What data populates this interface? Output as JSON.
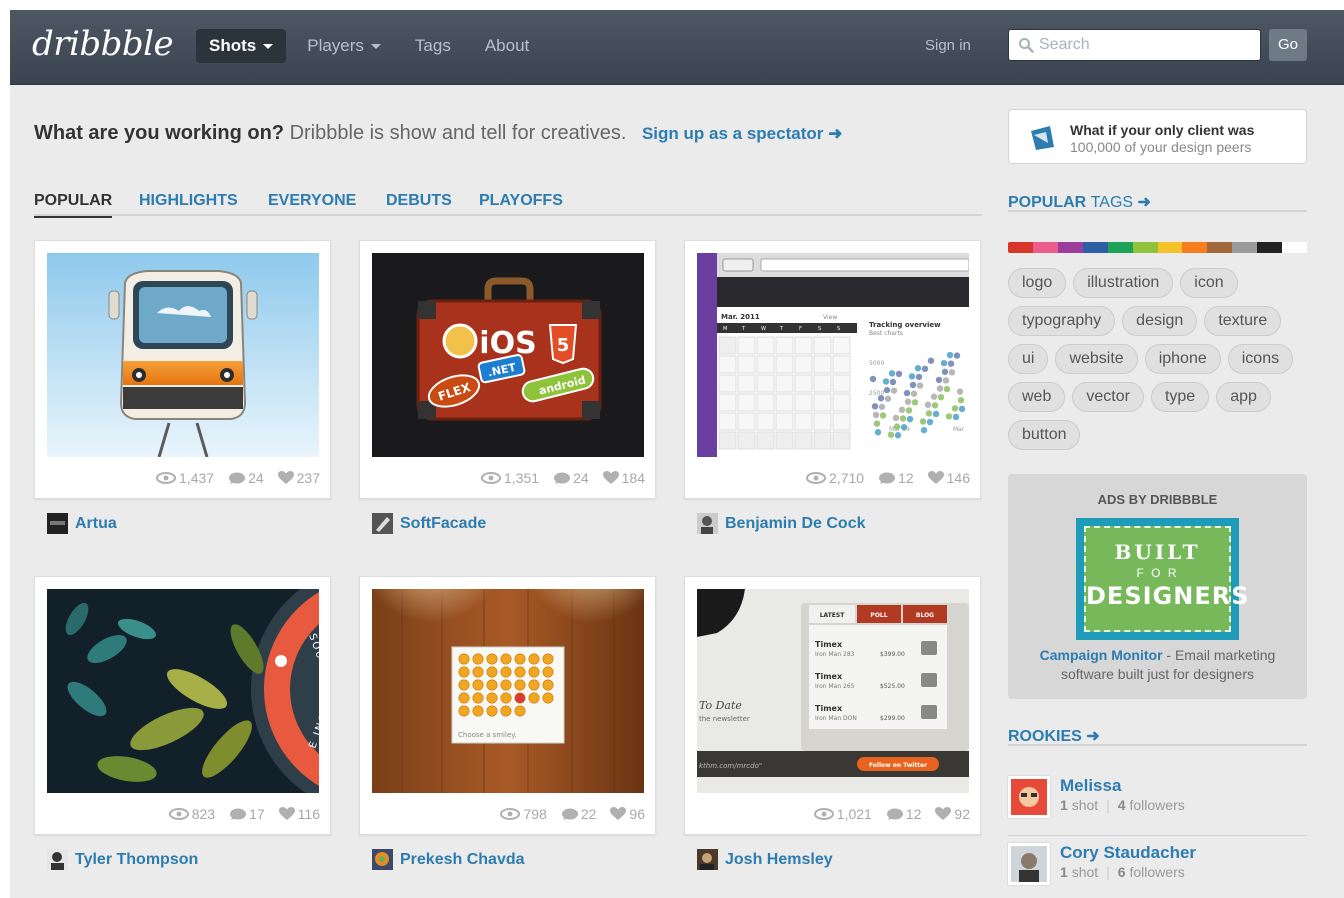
{
  "header": {
    "logo": "dribbble",
    "nav": [
      {
        "label": "Shots",
        "active": true,
        "dropdown": true
      },
      {
        "label": "Players",
        "active": false,
        "dropdown": true
      },
      {
        "label": "Tags",
        "active": false,
        "dropdown": false
      },
      {
        "label": "About",
        "active": false,
        "dropdown": false
      }
    ],
    "signin": "Sign in",
    "search_placeholder": "Search",
    "go_label": "Go"
  },
  "intro": {
    "question": "What are you working on?",
    "tagline": "Dribbble is show and tell for creatives.",
    "signup": "Sign up as a spectator",
    "arrow": "➜"
  },
  "tabs": [
    {
      "label": "Popular",
      "active": true
    },
    {
      "label": "Highlights",
      "active": false
    },
    {
      "label": "Everyone",
      "active": false
    },
    {
      "label": "Debuts",
      "active": false
    },
    {
      "label": "Playoffs",
      "active": false
    }
  ],
  "shots": [
    {
      "views": "1,437",
      "comments": "24",
      "likes": "237",
      "player": "Artua"
    },
    {
      "views": "1,351",
      "comments": "24",
      "likes": "184",
      "player": "SoftFacade"
    },
    {
      "views": "2,710",
      "comments": "12",
      "likes": "146",
      "player": "Benjamin De Cock"
    },
    {
      "views": "823",
      "comments": "17",
      "likes": "116",
      "player": "Tyler Thompson"
    },
    {
      "views": "798",
      "comments": "22",
      "likes": "96",
      "player": "Prekesh Chavda"
    },
    {
      "views": "1,021",
      "comments": "12",
      "likes": "92",
      "player": "Josh Hemsley"
    }
  ],
  "shot_art": {
    "suitcase_ios": "iOS",
    "suitcase_html": "5",
    "suitcase_net": ".NET",
    "suitcase_flex": "FLEX",
    "suitcase_android": "android",
    "calendar_month": "Mar. 2011",
    "calendar_view": "View",
    "calendar_days": [
      "M",
      "T",
      "W",
      "T",
      "F",
      "S",
      "S"
    ],
    "calendar_chart_title": "Tracking overview",
    "calendar_chart_sub": "Best charts",
    "calendar_y1": "5000",
    "calendar_y2": "2500",
    "calendar_x1": "Mar 09",
    "calendar_x2": "Mar",
    "smiley_caption": "Choose a smiley.",
    "timex_tabs": [
      "LATEST",
      "POLL",
      "BLOG"
    ],
    "timex_rows": [
      {
        "name": "Timex",
        "model": "Iron Man 283",
        "price": "$399.00"
      },
      {
        "name": "Timex",
        "model": "Iron Man 265",
        "price": "$525.00"
      },
      {
        "name": "Timex",
        "model": "Iron Man DON",
        "price": "$299.00"
      }
    ],
    "timex_left1": "To Date",
    "timex_left2": "the newsletter",
    "timex_url": "kthm.com/mrcdo\"",
    "timex_follow": "Follow on Twitter",
    "floral_text1": "SOUTH",
    "floral_text2": "E INC."
  },
  "sidebar": {
    "promo_title": "What if your only client was",
    "promo_sub": "100,000 of your design peers",
    "popular_tags_bold": "Popular",
    "popular_tags_light": "Tags",
    "arrow": "➜",
    "colors": [
      "#d7342a",
      "#ec5d8c",
      "#9c3d9d",
      "#2c5fa4",
      "#1ea158",
      "#8fc33b",
      "#f6c229",
      "#f57f1f",
      "#a3683a",
      "#9b9b9b",
      "#222222",
      "#ffffff"
    ],
    "tags": [
      "logo",
      "illustration",
      "icon",
      "typography",
      "design",
      "texture",
      "ui",
      "website",
      "iphone",
      "icons",
      "web",
      "vector",
      "type",
      "app",
      "button"
    ],
    "ads_label": "ADS BY DRIBBBLE",
    "stamp_l1": "BUILT",
    "stamp_l2": "F O R",
    "stamp_l3": "DESIGNERS",
    "ads_brand": "Campaign Monitor",
    "ads_text": " - Email marketing software built just for designers",
    "rookies_label": "Rookies",
    "rookies": [
      {
        "name": "Melissa",
        "shots": "1",
        "shots_label": "shot",
        "followers": "4",
        "followers_label": "followers"
      },
      {
        "name": "Cory Staudacher",
        "shots": "1",
        "shots_label": "shot",
        "followers": "6",
        "followers_label": "followers"
      }
    ]
  }
}
